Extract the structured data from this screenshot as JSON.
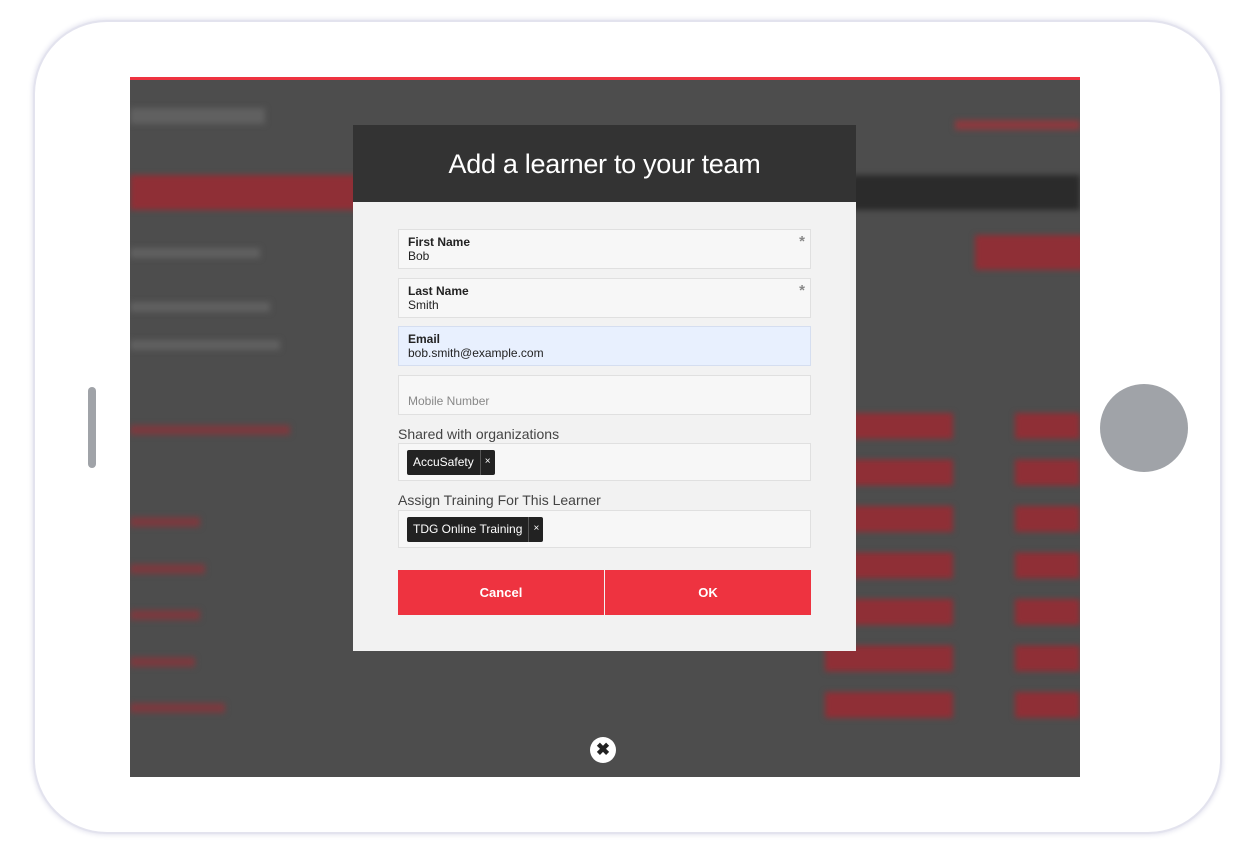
{
  "modal": {
    "title": "Add a learner to your team",
    "fields": [
      {
        "label": "First Name",
        "value": "Bob",
        "required": true
      },
      {
        "label": "Last Name",
        "value": "Smith",
        "required": true
      },
      {
        "label": "Email",
        "value": "bob.smith@example.com",
        "required": false
      },
      {
        "placeholder": "Mobile Number",
        "value": ""
      }
    ],
    "organizations": {
      "label": "Shared with organizations",
      "tags": [
        "AccuSafety"
      ]
    },
    "training": {
      "label": "Assign Training For This Learner",
      "tags": [
        "TDG Online Training"
      ]
    },
    "tag_remove": "×",
    "cancel_label": "Cancel",
    "ok_label": "OK",
    "close_icon": "✖"
  },
  "colors": {
    "accent": "#ee3340",
    "header": "#333333",
    "email_focus": "#e8f0fe"
  }
}
